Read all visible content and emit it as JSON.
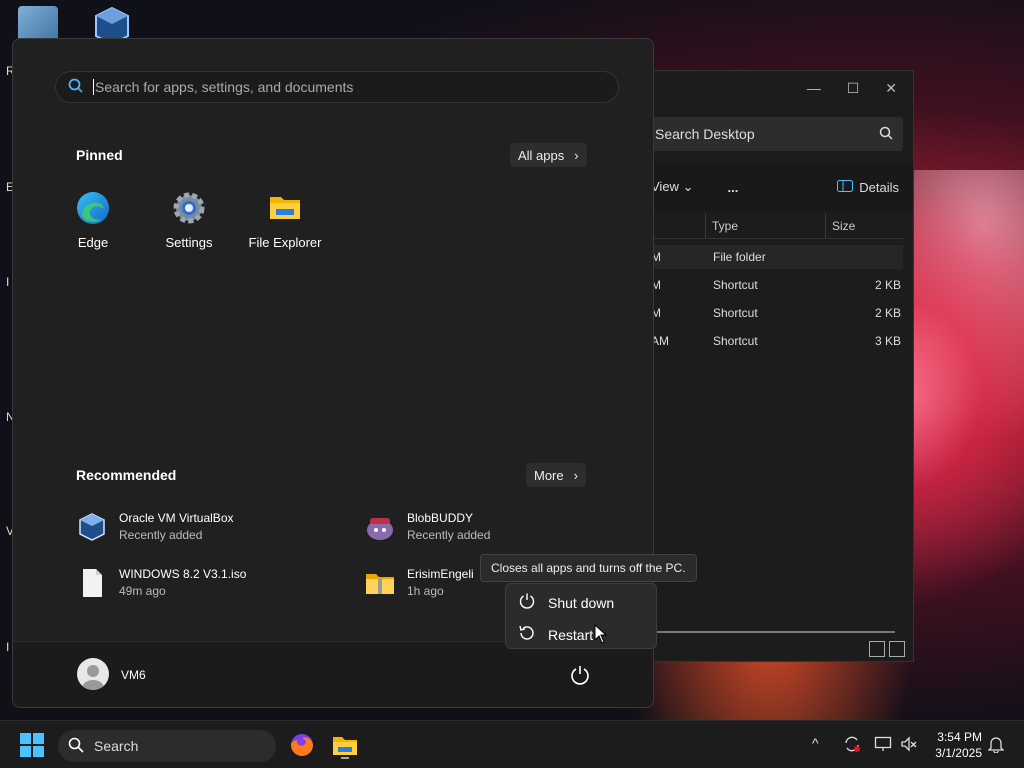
{
  "desktop": {
    "left_labels": [
      "R",
      "E",
      "I",
      "N",
      "Vi",
      "I"
    ]
  },
  "explorer": {
    "search_placeholder": "Search Desktop",
    "view_label": "View",
    "more_label": "...",
    "details_label": "Details",
    "columns": [
      "Type",
      "Size"
    ],
    "rows": [
      {
        "date": "M",
        "type": "File folder",
        "size": ""
      },
      {
        "date": "M",
        "type": "Shortcut",
        "size": "2 KB"
      },
      {
        "date": "M",
        "type": "Shortcut",
        "size": "2 KB"
      },
      {
        "date": "AM",
        "type": "Shortcut",
        "size": "3 KB"
      }
    ]
  },
  "start": {
    "search_placeholder": "Search for apps, settings, and documents",
    "pinned_title": "Pinned",
    "all_apps_label": "All apps",
    "pinned": [
      {
        "label": "Edge",
        "icon": "edge-icon"
      },
      {
        "label": "Settings",
        "icon": "settings-icon"
      },
      {
        "label": "File Explorer",
        "icon": "file-explorer-icon"
      }
    ],
    "recommended_title": "Recommended",
    "more_label": "More",
    "recommended": [
      {
        "name": "Oracle VM VirtualBox",
        "detail": "Recently added",
        "icon": "virtualbox-icon"
      },
      {
        "name": "BlobBUDDY",
        "detail": "Recently added",
        "icon": "blobbuddy-icon"
      },
      {
        "name": "WINDOWS 8.2 V3.1.iso",
        "detail": "49m ago",
        "icon": "file-icon"
      },
      {
        "name": "ErisimEngeli",
        "detail": "1h ago",
        "icon": "zip-folder-icon"
      }
    ],
    "user_name": "VM6",
    "tooltip": "Closes all apps and turns off the PC.",
    "power_menu": {
      "shutdown_label": "Shut down",
      "restart_label": "Restart"
    }
  },
  "taskbar": {
    "search_label": "Search",
    "time": "3:54 PM",
    "date": "3/1/2025"
  },
  "colors": {
    "accent": "#4cc2ff",
    "start_bg": "#202020",
    "taskbar_bg": "#1c1c1c"
  }
}
